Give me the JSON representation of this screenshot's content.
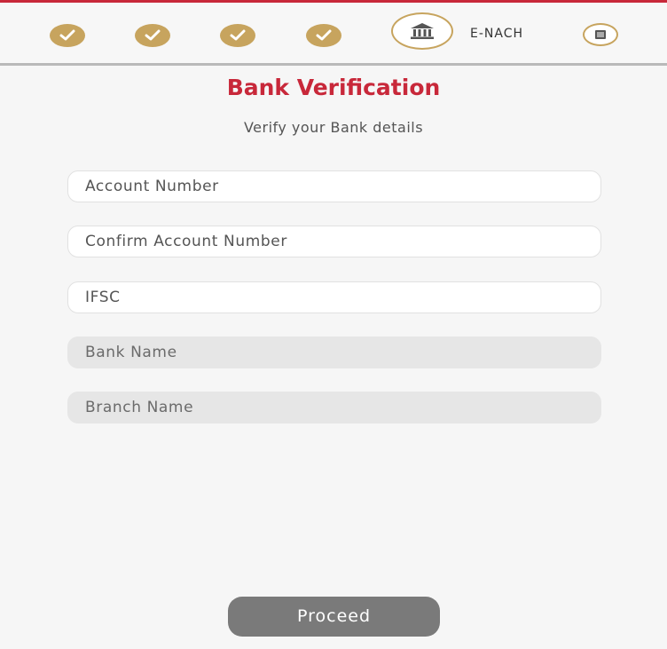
{
  "colors": {
    "accent": "#c8283a",
    "step_gold": "#c7a45e",
    "button_gray": "#7a7a7a"
  },
  "stepper": {
    "steps": [
      {
        "status": "completed",
        "icon": "check-icon"
      },
      {
        "status": "completed",
        "icon": "check-icon"
      },
      {
        "status": "completed",
        "icon": "check-icon"
      },
      {
        "status": "completed",
        "icon": "check-icon"
      },
      {
        "status": "current",
        "icon": "bank-icon"
      },
      {
        "status": "pending",
        "icon": "document-icon",
        "label": "E-NACH"
      }
    ]
  },
  "page": {
    "title": "Bank Verification",
    "subtitle": "Verify your Bank details"
  },
  "form": {
    "account_number": {
      "placeholder": "Account Number",
      "value": ""
    },
    "confirm_account_number": {
      "placeholder": "Confirm Account Number",
      "value": ""
    },
    "ifsc": {
      "placeholder": "IFSC",
      "value": ""
    },
    "bank_name": {
      "placeholder": "Bank Name",
      "value": ""
    },
    "branch_name": {
      "placeholder": "Branch Name",
      "value": ""
    }
  },
  "actions": {
    "proceed_label": "Proceed"
  }
}
